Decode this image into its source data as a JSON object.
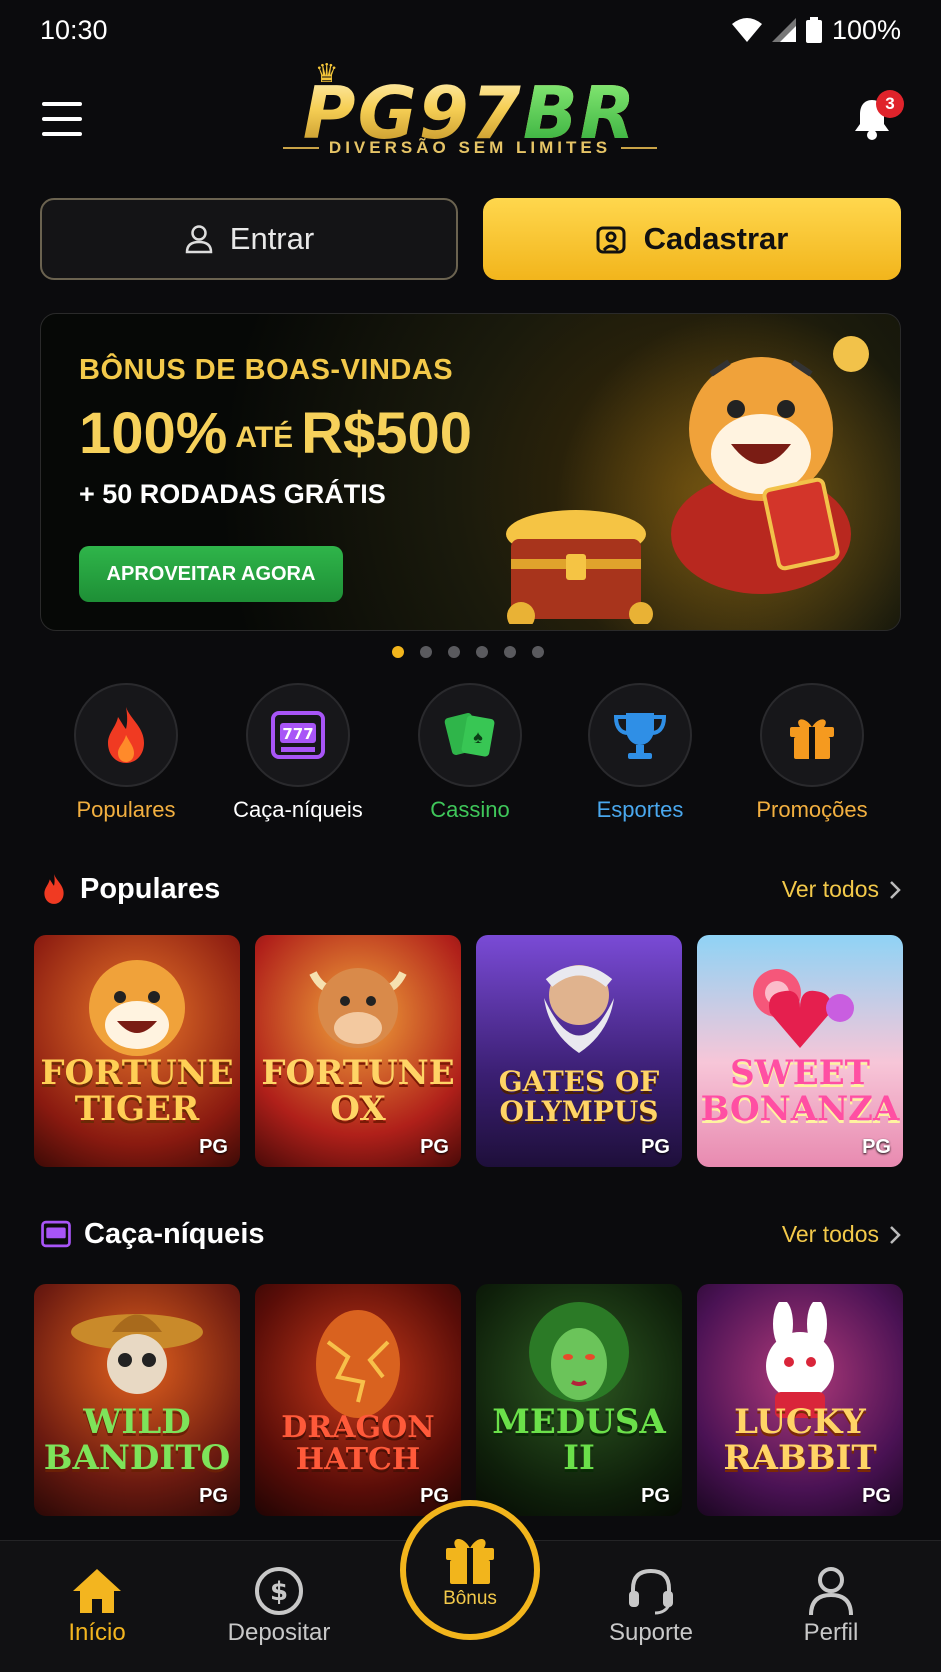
{
  "status": {
    "time": "10:30",
    "battery": "100%"
  },
  "header": {
    "logo_main": "PG97",
    "logo_accent": "BR",
    "tagline": "DIVERSÃO SEM LIMITES",
    "notifications": "3"
  },
  "auth": {
    "login_label": "Entrar",
    "register_label": "Cadastrar"
  },
  "banner": {
    "line1": "BÔNUS DE BOAS-VINDAS",
    "amount_a": "100%",
    "amount_mid": "ATÉ",
    "amount_b": "R$500",
    "line3": "+ 50 RODADAS GRÁTIS",
    "cta": "APROVEITAR AGORA",
    "slides": 6,
    "active_slide": 1
  },
  "categories": [
    {
      "label": "Populares",
      "icon": "fire-icon",
      "color": "#f3b040"
    },
    {
      "label": "Caça-níqueis",
      "icon": "slot-machine-icon",
      "color": "#ffffff"
    },
    {
      "label": "Cassino",
      "icon": "cards-icon",
      "color": "#3fc75a"
    },
    {
      "label": "Esportes",
      "icon": "trophy-icon",
      "color": "#4aa8ee"
    },
    {
      "label": "Promoções",
      "icon": "gift-icon",
      "color": "#f3b040"
    }
  ],
  "sections": {
    "popular": {
      "title": "Populares",
      "see_all": "Ver todos",
      "games": [
        {
          "name": "FORTUNE TIGER",
          "provider": "PG"
        },
        {
          "name": "FORTUNE OX",
          "provider": "PG"
        },
        {
          "name": "GATES OF OLYMPUS",
          "provider": "PG"
        },
        {
          "name": "SWEET BONANZA",
          "provider": "PG"
        }
      ]
    },
    "slots": {
      "title": "Caça-níqueis",
      "see_all": "Ver todos",
      "games": [
        {
          "name": "WILD BANDITO",
          "provider": "PG"
        },
        {
          "name": "DRAGON HATCH",
          "provider": "PG"
        },
        {
          "name": "MEDUSA II",
          "provider": "PG"
        },
        {
          "name": "LUCKY RABBIT",
          "provider": "PG"
        }
      ]
    }
  },
  "nav": {
    "home": "Início",
    "deposit": "Depositar",
    "bonus": "Bônus",
    "support": "Suporte",
    "profile": "Perfil"
  },
  "colors": {
    "accent": "#f2b51c",
    "background": "#0b0b0d",
    "success": "#2fb54a"
  }
}
